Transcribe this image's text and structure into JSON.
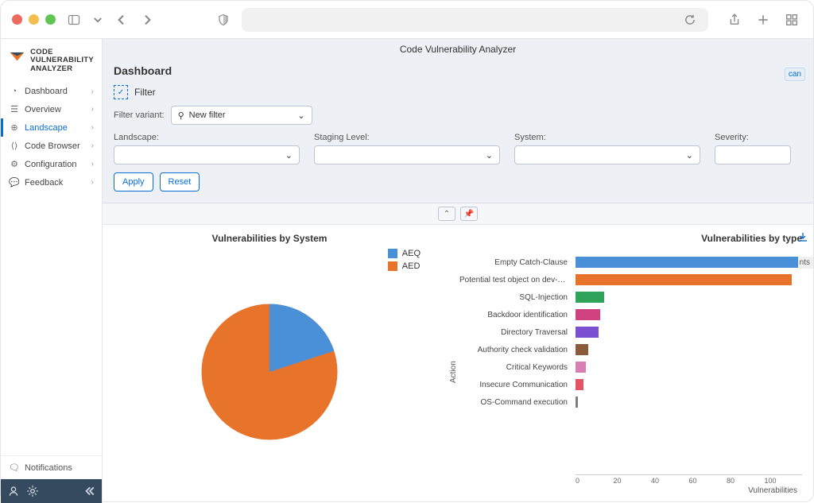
{
  "browser": {
    "reload_icon": "reload",
    "share_icon": "share",
    "add_icon": "add",
    "grid_icon": "grid"
  },
  "app": {
    "title": "Code Vulnerability Analyzer",
    "logo_line1": "CODE",
    "logo_line2": "VULNERABILITY",
    "logo_line3": "ANALYZER"
  },
  "sidebar": {
    "items": [
      {
        "label": "Dashboard",
        "icon": "speedometer"
      },
      {
        "label": "Overview",
        "icon": "list"
      },
      {
        "label": "Landscape",
        "icon": "globe"
      },
      {
        "label": "Code Browser",
        "icon": "code"
      },
      {
        "label": "Configuration",
        "icon": "gear"
      },
      {
        "label": "Feedback",
        "icon": "chat"
      }
    ],
    "notifications": "Notifications"
  },
  "dashboard": {
    "heading": "Dashboard",
    "can_label": "can",
    "filter": {
      "title": "Filter",
      "variant_label": "Filter variant:",
      "variant_value": "New filter",
      "fields": {
        "landscape": "Landscape:",
        "staging": "Staging Level:",
        "system": "System:",
        "severity": "Severity:"
      },
      "apply": "Apply",
      "reset": "Reset"
    }
  },
  "chart_data": [
    {
      "type": "pie",
      "title": "Vulnerabilities by System",
      "series": [
        {
          "name": "AEQ",
          "value": 20,
          "color": "#4a90d9"
        },
        {
          "name": "AED",
          "value": 80,
          "color": "#e8742c"
        }
      ],
      "legend": [
        "AEQ",
        "AED"
      ]
    },
    {
      "type": "bar",
      "title": "Vulnerabilities by type",
      "xlabel": "Vulnerabilities",
      "ylabel": "Action",
      "xlim": [
        0,
        110
      ],
      "ticks": [
        0,
        20,
        40,
        60,
        80,
        100
      ],
      "categories": [
        "Empty Catch-Clause",
        "Potential test object on dev-system",
        "SQL-Injection",
        "Backdoor identification",
        "Directory Traversal",
        "Authority check validation",
        "Critical Keywords",
        "Insecure Communication",
        "OS-Command execution"
      ],
      "values": [
        108,
        105,
        14,
        12,
        11,
        6,
        5,
        4,
        1
      ],
      "colors": [
        "#4a90d9",
        "#e8742c",
        "#2fa35a",
        "#d0417f",
        "#7a4fd1",
        "#8a5a3a",
        "#d97fb4",
        "#e25563",
        "#7f7f7f"
      ],
      "nts_label": "nts"
    }
  ]
}
